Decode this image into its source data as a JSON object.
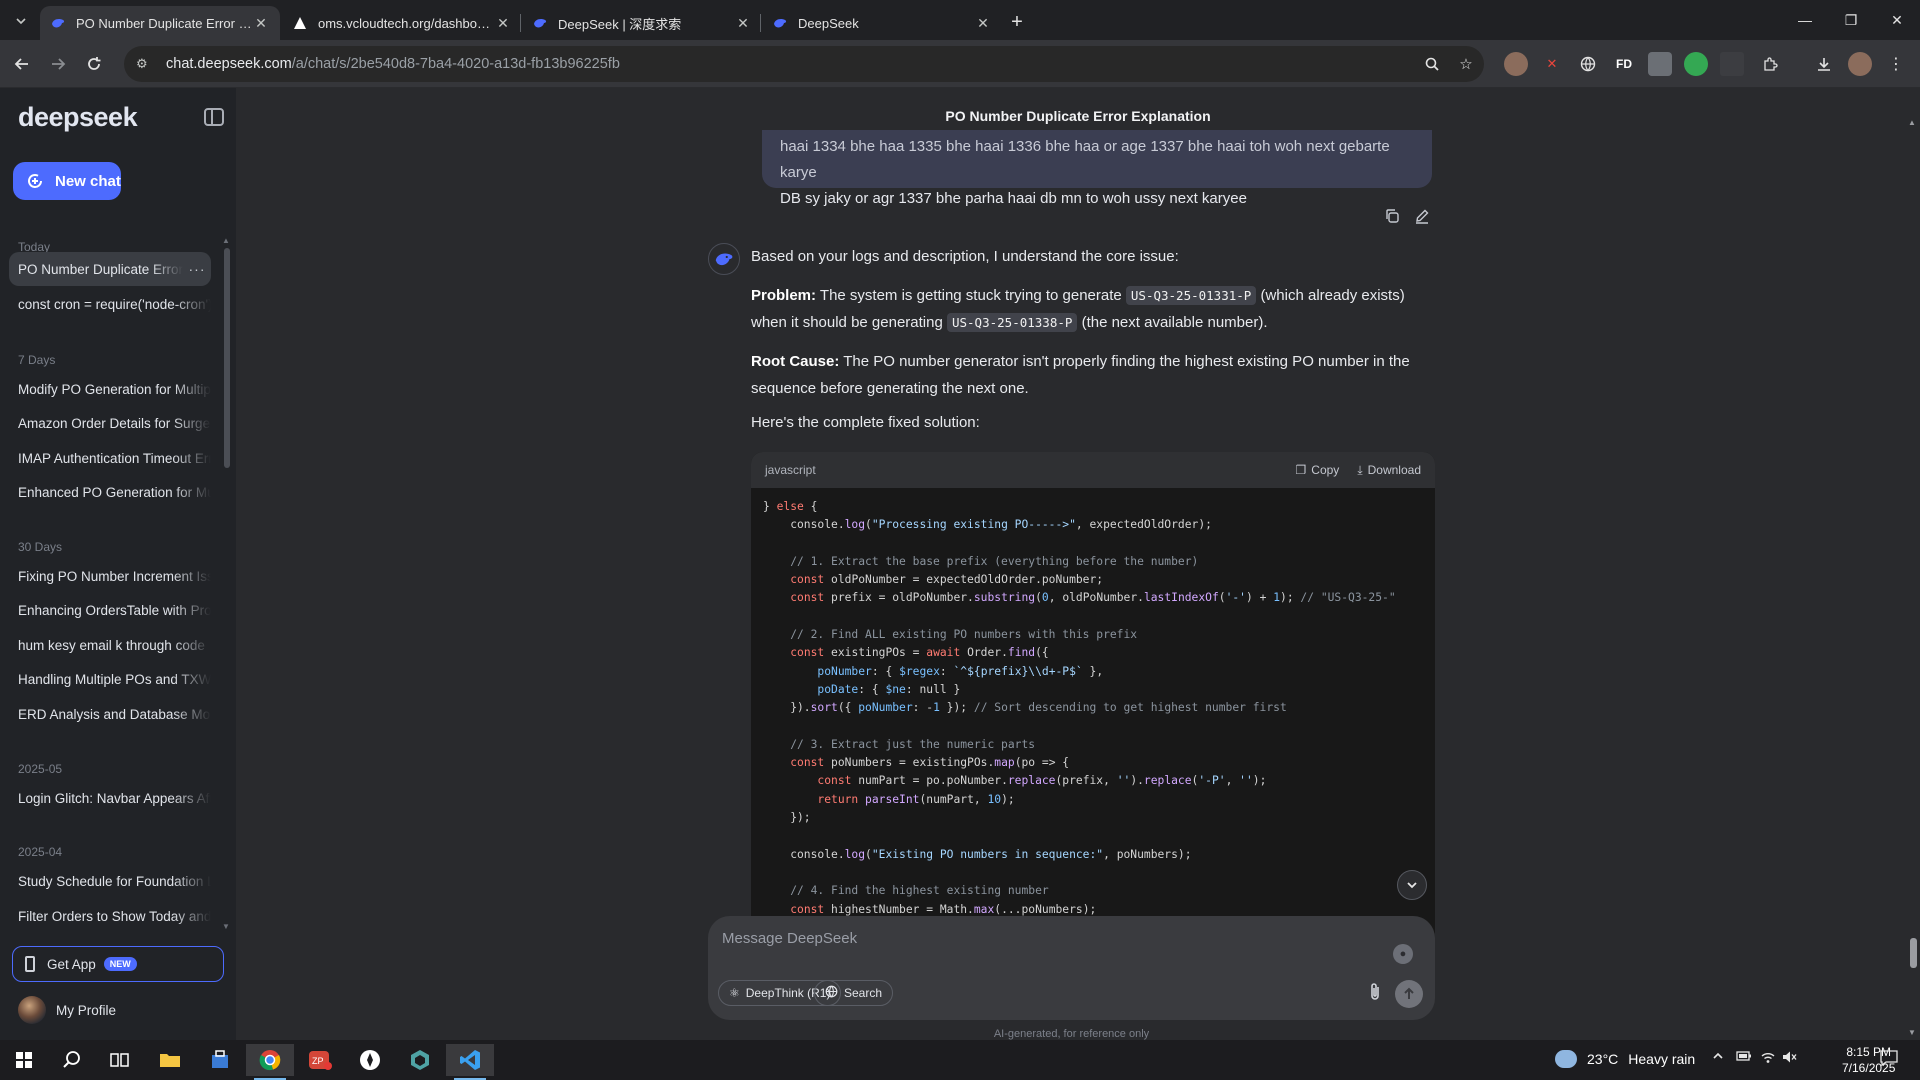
{
  "browser": {
    "tabs": [
      {
        "title": "PO Number Duplicate Error Exp",
        "active": true,
        "favicon": "deepseek-whale-icon"
      },
      {
        "title": "oms.vcloudtech.org/dashboard",
        "active": false,
        "favicon": "triangle-icon"
      },
      {
        "title": "DeepSeek | 深度求索",
        "active": false,
        "favicon": "deepseek-whale-icon"
      },
      {
        "title": "DeepSeek",
        "active": false,
        "favicon": "deepseek-whale-icon"
      }
    ],
    "url_host": "chat.deepseek.com",
    "url_path": "/a/chat/s/2be540d8-7ba4-4020-a13d-fb13b96225fb",
    "extension_label": "FD"
  },
  "sidebar": {
    "logo": "deepseek",
    "new_chat": "New chat",
    "sections": {
      "today": "Today",
      "days7": "7 Days",
      "days30": "30 Days",
      "m2025_05": "2025-05",
      "m2025_04": "2025-04"
    },
    "chats": {
      "today": [
        "PO Number Duplicate Error Explanation",
        "const cron = require('node-cron')"
      ],
      "days7": [
        "Modify PO Generation for Multiple",
        "Amazon Order Details for Surge",
        "IMAP Authentication Timeout Error",
        "Enhanced PO Generation for Multiple"
      ],
      "days30": [
        "Fixing PO Number Increment Issue",
        "Enhancing OrdersTable with Props",
        "hum kesy email k through code",
        "Handling Multiple POs and TXW",
        "ERD Analysis and Database Model"
      ],
      "m2025_05": [
        "Login Glitch: Navbar Appears After"
      ],
      "m2025_04": [
        "Study Schedule for Foundation Level",
        "Filter Orders to Show Today and"
      ]
    },
    "more_label": "···",
    "get_app": "Get App",
    "get_app_badge": "NEW",
    "profile": "My Profile"
  },
  "conversation": {
    "title": "PO Number Duplicate Error Explanation",
    "user_message_line1": "haai 1334 bhe haa 1335 bhe haai 1336 bhe haa or age 1337 bhe haai toh woh next gebarte karye",
    "user_message_line2": "DB sy jaky or agr 1337 bhe parha haai db mn to woh ussy next karyee",
    "intro": "Based on your logs and description, I understand the core issue:",
    "problem_label": "Problem:",
    "problem_a": " The system is getting stuck trying to generate ",
    "problem_code1": "US-Q3-25-01331-P",
    "problem_b": " (which already exists) when it should be generating ",
    "problem_code2": "US-Q3-25-01338-P",
    "problem_c": " (the next available number).",
    "root_label": "Root Cause:",
    "root_text": " The PO number generator isn't properly finding the highest existing PO number in the sequence before generating the next one.",
    "solution_intro": "Here's the complete fixed solution:",
    "code_lang": "javascript",
    "copy_label": "Copy",
    "download_label": "Download",
    "code_lines": [
      "} else {",
      "    console.log(\"Processing existing PO----->\", expectedOldOrder);",
      "",
      "    // 1. Extract the base prefix (everything before the number)",
      "    const oldPoNumber = expectedOldOrder.poNumber;",
      "    const prefix = oldPoNumber.substring(0, oldPoNumber.lastIndexOf('-') + 1); // \"US-Q3-25-\"",
      "",
      "    // 2. Find ALL existing PO numbers with this prefix",
      "    const existingPOs = await Order.find({",
      "        poNumber: { $regex: `^${prefix}\\\\d+-P$` },",
      "        poDate: { $ne: null }",
      "    }).sort({ poNumber: -1 }); // Sort descending to get highest number first",
      "",
      "    // 3. Extract just the numeric parts",
      "    const poNumbers = existingPOs.map(po => {",
      "        const numPart = po.poNumber.replace(prefix, '').replace('-P', '');",
      "        return parseInt(numPart, 10);",
      "    });",
      "",
      "    console.log(\"Existing PO numbers in sequence:\", poNumbers);",
      "",
      "    // 4. Find the highest existing number",
      "    const highestNumber = Math.max(...poNumbers);"
    ]
  },
  "composer": {
    "placeholder": "Message DeepSeek",
    "deepthink": "DeepThink (R1)",
    "search": "Search",
    "disclaimer": "AI-generated, for reference only"
  },
  "taskbar": {
    "weather_temp": "23°C",
    "weather_text": "Heavy rain",
    "time": "8:15 PM",
    "date": "7/16/2025",
    "zoom_badge": "5"
  },
  "colors": {
    "accent": "#4d6bfe",
    "sidebar_bg": "#212327",
    "page_bg": "#292a2d",
    "code_bg": "#181818"
  }
}
